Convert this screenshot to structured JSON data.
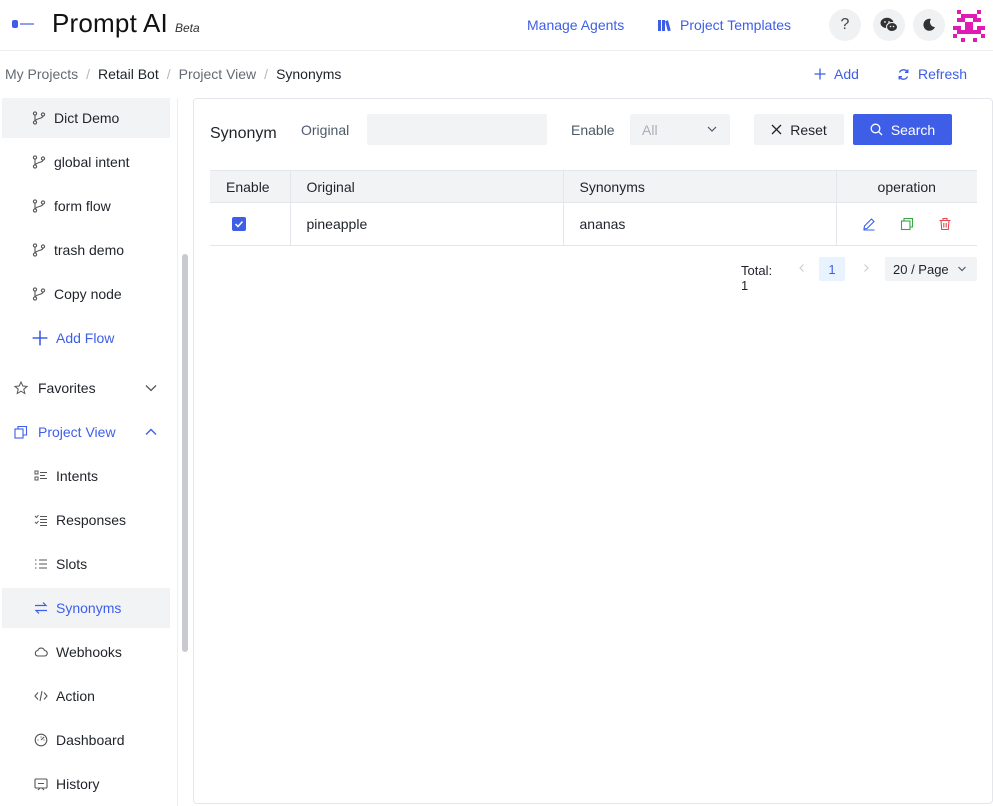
{
  "header": {
    "brand": "Prompt AI",
    "badge": "Beta",
    "nav": {
      "agents": "Manage Agents",
      "templates": "Project Templates"
    },
    "help_symbol": "?",
    "icons": {
      "logo": "app-logo-icon",
      "templates": "library-icon",
      "wechat": "wechat-icon",
      "theme": "moon-icon",
      "avatar": "pixel-avatar-icon"
    }
  },
  "breadcrumb": {
    "items": [
      "My Projects",
      "Retail Bot",
      "Project View",
      "Synonyms"
    ],
    "separator": "/"
  },
  "toolbar": {
    "add_label": "Add",
    "refresh_label": "Refresh"
  },
  "sidebar": {
    "flows": [
      {
        "label": "Dict Demo",
        "icon": "branch-icon"
      },
      {
        "label": "global intent",
        "icon": "branch-icon"
      },
      {
        "label": "form flow",
        "icon": "branch-icon"
      },
      {
        "label": "trash demo",
        "icon": "branch-icon"
      },
      {
        "label": "Copy node",
        "icon": "branch-icon"
      }
    ],
    "add_flow": "Add Flow",
    "favorites": "Favorites",
    "project_view": "Project View",
    "project_items": [
      {
        "label": "Intents",
        "icon": "intents-icon"
      },
      {
        "label": "Responses",
        "icon": "responses-icon"
      },
      {
        "label": "Slots",
        "icon": "slots-icon"
      },
      {
        "label": "Synonyms",
        "icon": "swap-icon",
        "active": true
      },
      {
        "label": "Webhooks",
        "icon": "cloud-icon"
      },
      {
        "label": "Action",
        "icon": "code-icon"
      },
      {
        "label": "Dashboard",
        "icon": "dashboard-icon"
      },
      {
        "label": "History",
        "icon": "history-icon"
      }
    ]
  },
  "filter": {
    "title": "Synonym",
    "original_label": "Original",
    "original_value": "",
    "enable_label": "Enable",
    "enable_value": "All",
    "reset_label": "Reset",
    "search_label": "Search"
  },
  "table": {
    "columns": [
      "Enable",
      "Original",
      "Synonyms",
      "operation"
    ],
    "rows": [
      {
        "enabled": true,
        "original": "pineapple",
        "synonyms": "ananas"
      }
    ]
  },
  "pagination": {
    "total": "Total: 1",
    "current_page": "1",
    "page_size": "20 / Page"
  },
  "colors": {
    "accent": "#3e5ee8",
    "copy": "#3aa547",
    "delete": "#e5484d"
  }
}
